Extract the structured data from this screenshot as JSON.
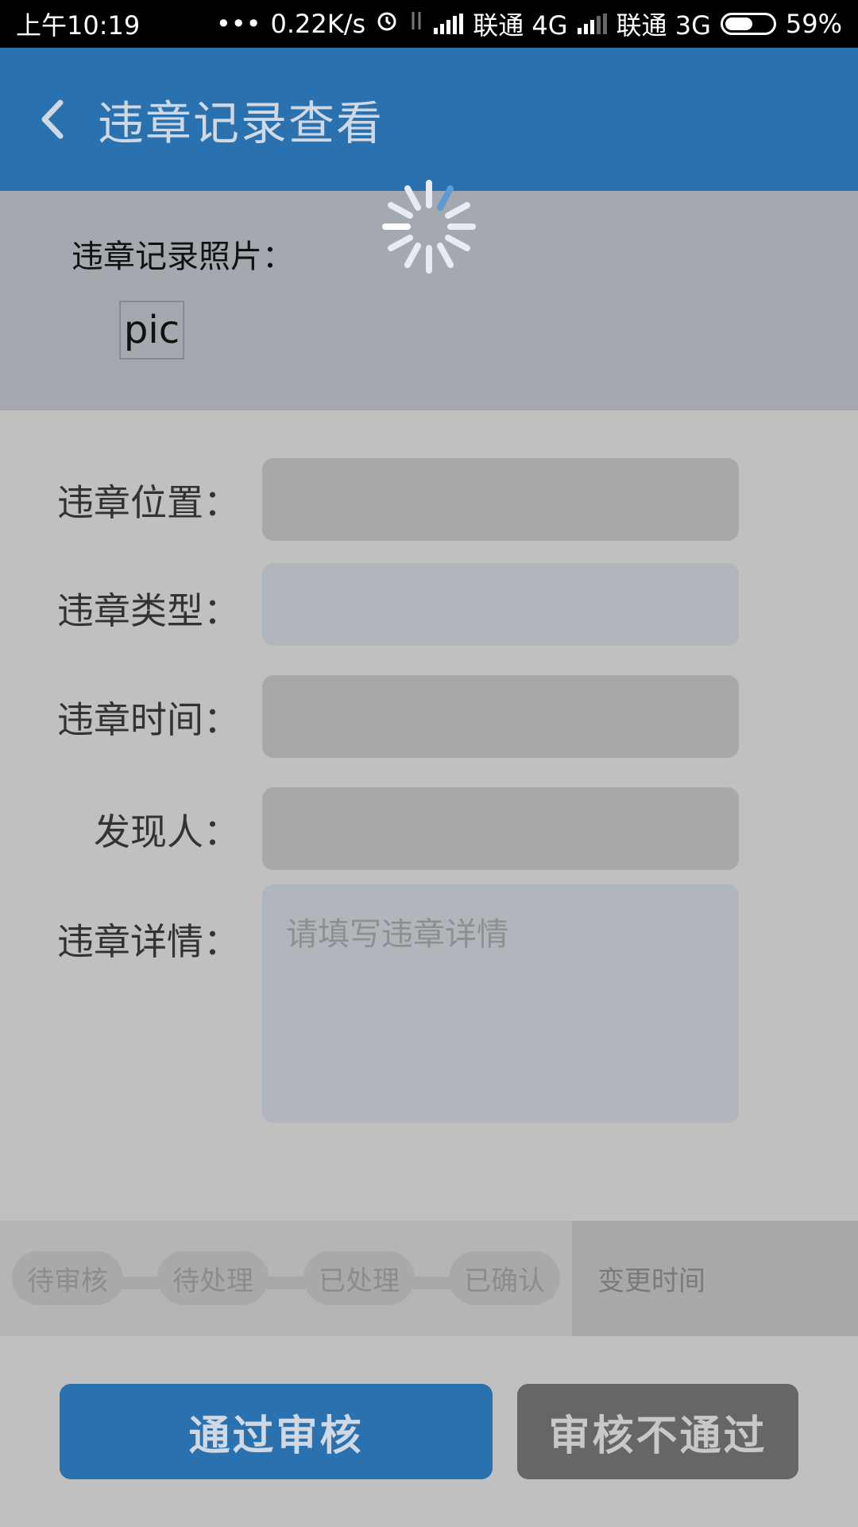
{
  "status_bar": {
    "time": "上午10:19",
    "dots": "•••",
    "speed": "0.22K/s",
    "carrier1": "联通 4G",
    "carrier2": "联通 3G",
    "battery": "59%"
  },
  "app_bar": {
    "title": "违章记录查看"
  },
  "photo": {
    "label": "违章记录照片：",
    "pic_text": "pic"
  },
  "form": {
    "location_label": "违章位置：",
    "type_label": "违章类型：",
    "time_label": "违章时间：",
    "finder_label": "发现人：",
    "detail_label": "违章详情：",
    "detail_placeholder": "请填写违章详情"
  },
  "status_track": {
    "steps": [
      "待审核",
      "待处理",
      "已处理",
      "已确认"
    ],
    "change_time_label": "变更时间"
  },
  "actions": {
    "approve_label": "通过审核",
    "reject_label": "审核不通过"
  },
  "colors": {
    "primary": "#2a71b0",
    "overlay": "#c0c0c0",
    "reject": "#666666"
  }
}
